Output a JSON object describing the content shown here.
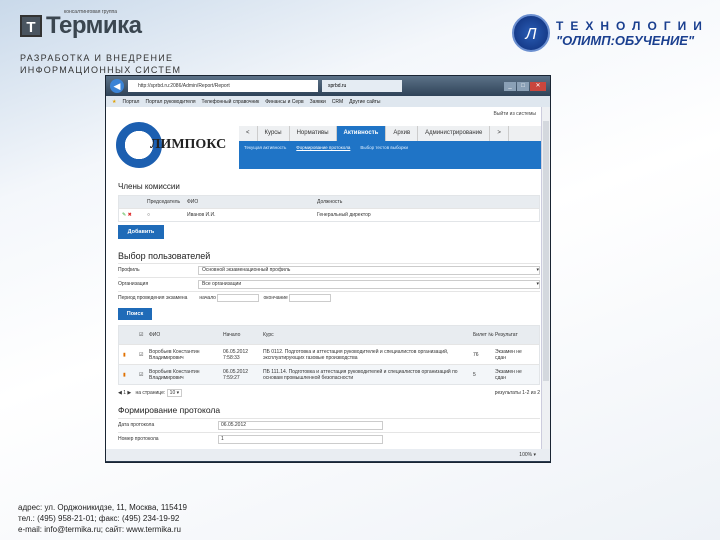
{
  "slide": {
    "brand_small": "консалтинговая группа",
    "brand_letter": "Т",
    "brand_name": "Термика",
    "tagline1": "РАЗРАБОТКА И ВНЕДРЕНИЕ",
    "tagline2": "ИНФОРМАЦИОННЫХ СИСТЕМ",
    "olimp_letter": "Л",
    "olimp_line1": "ТЕХНОЛОГИИ",
    "olimp_line2": "\"ОЛИМП:ОБУЧЕНИЕ\"",
    "footer": [
      "адрес: ул. Орджоникидзе, 11, Москва, 115419",
      "тел.: (495) 958-21-01; факс: (495) 234-19-92",
      "e-mail: info@termika.ru; сайт: www.termika.ru"
    ]
  },
  "browser": {
    "url": "http://sprbd.ru:2086/Admin/Report/Report",
    "tab": "sprbd.ru",
    "favorites": [
      "Портал",
      "Портал руководителя",
      "Телефонный справочник",
      "Финансы и Серв",
      "Заявки",
      "CRM",
      "Другие сайты"
    ],
    "zoom": "100%"
  },
  "app": {
    "logo": "ЛИМПОКС",
    "logout": "Выйти из системы",
    "nav": [
      "<",
      "Курсы",
      "Нормативы",
      "Активность",
      "Архив",
      "Администрирование",
      ">"
    ],
    "subnav": [
      "Текущая активность",
      "Формирование протокола",
      "Выбор тестов выборки"
    ],
    "commission": {
      "title": "Члены комиссии",
      "headers": [
        "Председатель",
        "ФИО",
        "Должность"
      ],
      "rows": [
        {
          "fio": "Иванов И.И.",
          "position": "Генеральный директор"
        }
      ],
      "add": "Добавить"
    },
    "users": {
      "title": "Выбор пользователей",
      "profile_label": "Профиль",
      "profile_value": "Основной экзаменационный профиль",
      "org_label": "Организация",
      "org_value": "Все организации",
      "period_label": "Период проведения экзамена",
      "from": "начало",
      "to": "окончание",
      "search": "Поиск"
    },
    "results": {
      "headers": [
        "ФИО",
        "Начало",
        "Курс",
        "Билет №",
        "Результат"
      ],
      "rows": [
        {
          "fio": "Воробьев Константин Владимирович",
          "start": "06.05.2012 7:58:33",
          "course": "ПБ 0112. Подготовка и аттестация руководителей и специалистов организаций, эксплуатирующих газовые производства",
          "ticket": "76",
          "result": "Экзамен не сдан"
        },
        {
          "fio": "Воробьев Константин Владимирович",
          "start": "06.05.2012 7:59:27",
          "course": "ПБ 111.14. Подготовка и аттестация руководителей и специалистов организаций по основам промышленной безопасности",
          "ticket": "5",
          "result": "Экзамен не сдан"
        }
      ],
      "pager": "1",
      "per_page_label": "на странице:",
      "per_page": "10",
      "count": "результаты 1-2 из 2"
    },
    "protocol": {
      "title": "Формирование протокола",
      "date_label": "Дата протокола",
      "date_value": "06.05.2012",
      "num_label": "Номер протокола",
      "num_value": "1"
    }
  }
}
